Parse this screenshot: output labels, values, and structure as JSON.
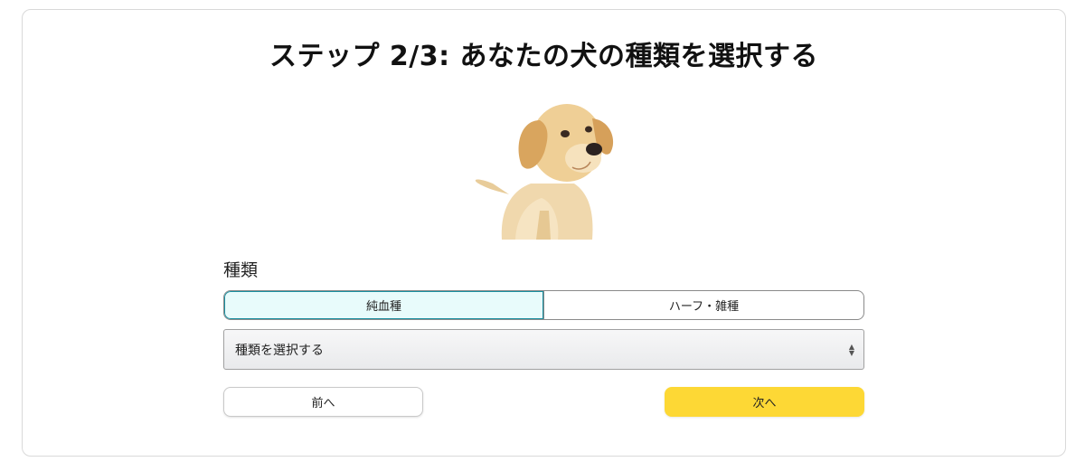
{
  "step": {
    "title": "ステップ 2/3: あなたの犬の種類を選択する"
  },
  "breed_section": {
    "label": "種類",
    "segments": [
      {
        "label": "純血種",
        "selected": true
      },
      {
        "label": "ハーフ・雑種",
        "selected": false
      }
    ],
    "select": {
      "value": "種類を選択する",
      "icon": "updown-arrows-icon"
    }
  },
  "nav": {
    "prev_label": "前へ",
    "next_label": "次へ"
  },
  "colors": {
    "accent_yellow": "#fdd835",
    "selected_segment_bg": "#e8fbfb",
    "selected_segment_border": "#1a8fa0"
  }
}
